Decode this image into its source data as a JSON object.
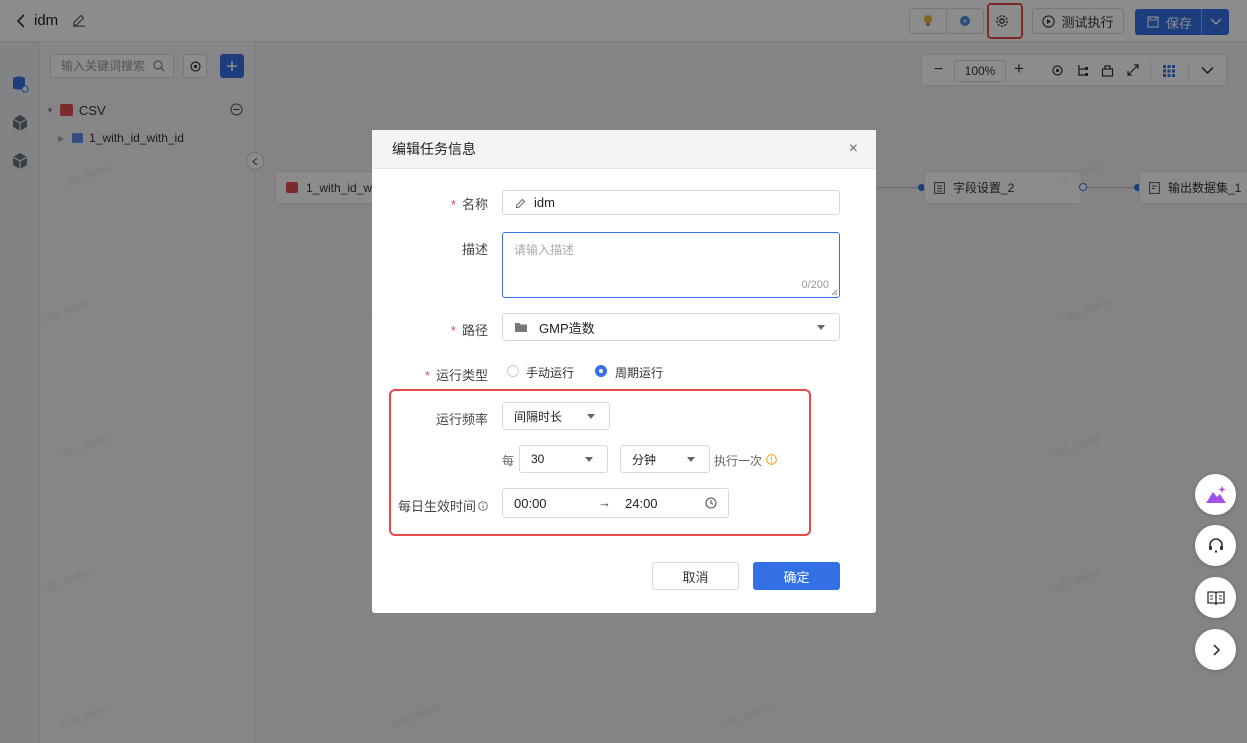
{
  "header": {
    "back_label": "<",
    "task_title": "idm",
    "test_run_label": "测试执行",
    "save_label": "保存"
  },
  "left_panel": {
    "search_placeholder": "输入关键词搜索",
    "root_item": "CSV",
    "child_item": "1_with_id_with_id"
  },
  "canvas": {
    "zoom_level": "100%",
    "nodes": [
      {
        "label": "1_with_id_wit"
      },
      {
        "label": "字段设置_2"
      },
      {
        "label": "输出数据集_1"
      }
    ],
    "watermark": "cdp_demo"
  },
  "dialog": {
    "title": "编辑任务信息",
    "name_label": "名称",
    "name_value": "idm",
    "desc_label": "描述",
    "desc_placeholder": "请输入描述",
    "desc_counter": "0/200",
    "path_label": "路径",
    "path_value": "GMP造数",
    "run_type_label": "运行类型",
    "run_type_options": [
      "手动运行",
      "周期运行"
    ],
    "run_type_selected": "周期运行",
    "frequency_label": "运行频率",
    "frequency_value": "间隔时长",
    "every_label": "每",
    "interval_value": "30",
    "unit_value": "分钟",
    "execute_once_label": "执行一次",
    "effective_time_label": "每日生效时间",
    "start_time": "00:00",
    "time_arrow": "→",
    "end_time": "24:00",
    "cancel_label": "取消",
    "confirm_label": "确定"
  },
  "colors": {
    "primary": "#3370e6",
    "highlight": "#e84a4a",
    "warning": "#f5a623"
  }
}
